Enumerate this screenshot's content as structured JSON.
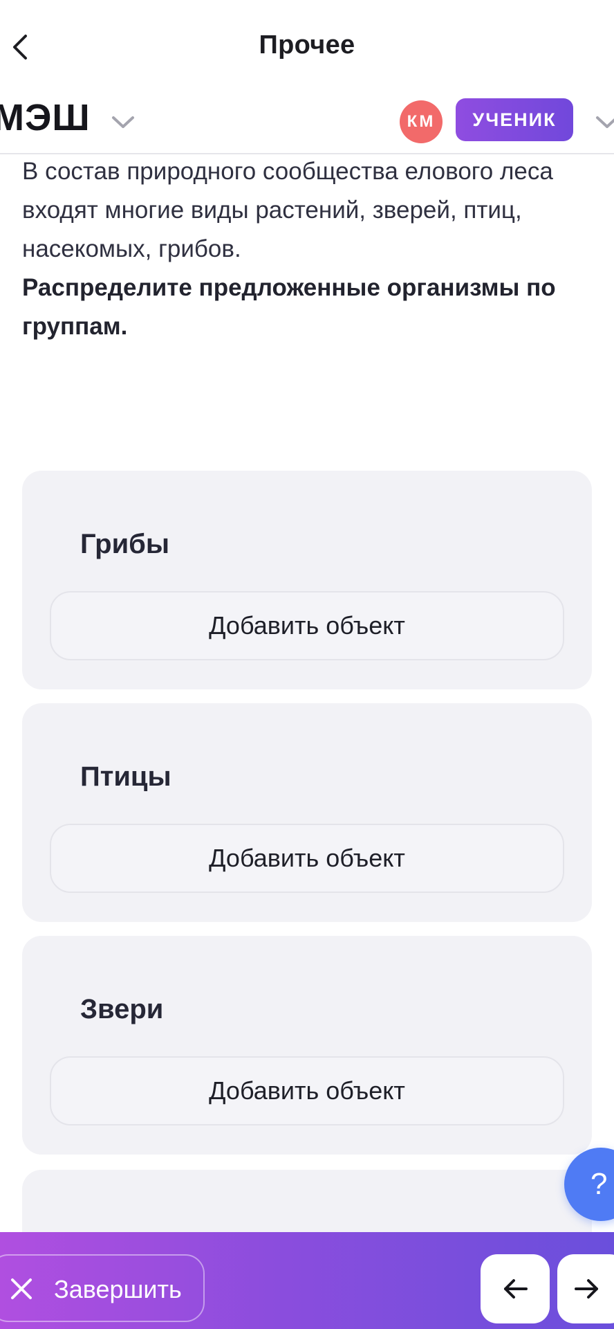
{
  "nav": {
    "title": "Прочее",
    "back_icon": "chevron-left-icon"
  },
  "header": {
    "logo_text": "МЭШ",
    "avatar_initials": "КМ",
    "avatar_color": "#f26a6a",
    "role_label": "УЧЕНИК",
    "role_color": "#8f4de0"
  },
  "task": {
    "intro": "В состав природного сообщества елового леса входят многие виды растений, зверей, птиц, насекомых, грибов.",
    "instruction": "Распределите предложенные организмы по группам."
  },
  "groups": [
    {
      "title": "Грибы",
      "add_label": "Добавить объект"
    },
    {
      "title": "Птицы",
      "add_label": "Добавить объект"
    },
    {
      "title": "Звери",
      "add_label": "Добавить объект"
    }
  ],
  "help": {
    "label": "?",
    "color": "#4f7bf4"
  },
  "bottom_bar": {
    "finish_label": "Завершить",
    "finish_icon": "close-icon",
    "prev_icon": "arrow-left-icon",
    "next_icon": "arrow-right-icon"
  }
}
